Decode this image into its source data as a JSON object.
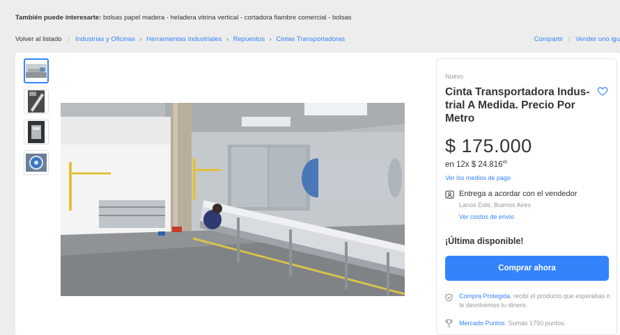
{
  "related": {
    "prefix": "También puede interesarte:",
    "items": "bolsas papel madera - heladera vitrina vertical - cortadora fiambre comercial - bolsas"
  },
  "nav": {
    "back": "Volver al listado",
    "breadcrumbs": [
      "Industrias y Oficinas",
      "Herramientas Industriales",
      "Repuestos",
      "Cintas Transportadoras"
    ],
    "share": "Compartir",
    "sell": "Vender uno igu"
  },
  "gallery": {
    "thumbnail_count": 4,
    "main_image": "industrial-conveyor-belt-photo"
  },
  "product": {
    "condition": "Nuevo",
    "title": "Cinta Transportadora Indus-trial A Medida. Precio Por Metro",
    "price": "$ 175.000",
    "installments": "en 12x $ 24.816",
    "installments_cents": "45",
    "payment_link": "Ver los medios de pago",
    "shipping": "Entrega a acordar con el vendedor",
    "location": "Lanús Este, Buenos Aires",
    "shipping_costs": "Ver costos de envío",
    "stock": "¡Última disponible!",
    "buy_button": "Comprar ahora",
    "protected_link": "Compra Protegida",
    "protected_text": ", recibí el producto que esperabas o te devolvemos tu dinero.",
    "points_link": "Mercado Puntos",
    "points_text": ". Sumás 1750 puntos."
  },
  "colors": {
    "accent": "#3483fa",
    "background": "#ededed",
    "card": "#ffffff"
  }
}
